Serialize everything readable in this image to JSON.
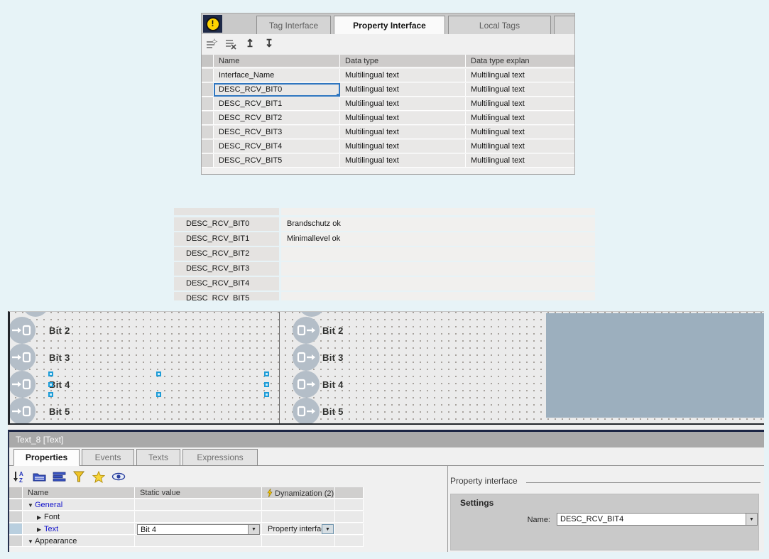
{
  "colors": {
    "page_bg": "#e7f3f7",
    "panel_bg": "#f0f0f0",
    "navy": "#1e2947",
    "warning_yellow": "#ffd400",
    "selection_blue": "#2f76c0",
    "handle_blue": "#1e9cd7",
    "link_blue": "#1313cb",
    "canvas_rect_blue_gray": "#9cafbe",
    "icon_circle_gray": "#b4bec8",
    "title_bar_gray": "#a9a9a9"
  },
  "top_panel": {
    "warning_icon": "warning-icon",
    "tabs": [
      {
        "label": "Tag Interface",
        "active": false
      },
      {
        "label": "Property Interface",
        "active": true
      },
      {
        "label": "Local Tags",
        "active": false
      }
    ],
    "toolbar_icons": [
      "add-row-icon",
      "delete-row-icon",
      "move-up-icon",
      "move-down-icon"
    ],
    "move_up_glyph": "↥",
    "move_down_glyph": "↧",
    "table": {
      "columns": [
        "Name",
        "Data type",
        "Data type explan"
      ],
      "rows": [
        {
          "name": "Interface_Name",
          "data_type": "Multilingual text",
          "explanation": "Multilingual text",
          "selected": false
        },
        {
          "name": "DESC_RCV_BIT0",
          "data_type": "Multilingual text",
          "explanation": "Multilingual text",
          "selected": true
        },
        {
          "name": "DESC_RCV_BIT1",
          "data_type": "Multilingual text",
          "explanation": "Multilingual text",
          "selected": false
        },
        {
          "name": "DESC_RCV_BIT2",
          "data_type": "Multilingual text",
          "explanation": "Multilingual text",
          "selected": false
        },
        {
          "name": "DESC_RCV_BIT3",
          "data_type": "Multilingual text",
          "explanation": "Multilingual text",
          "selected": false
        },
        {
          "name": "DESC_RCV_BIT4",
          "data_type": "Multilingual text",
          "explanation": "Multilingual text",
          "selected": false
        },
        {
          "name": "DESC_RCV_BIT5",
          "data_type": "Multilingual text",
          "explanation": "Multilingual text",
          "selected": false
        }
      ]
    }
  },
  "middle_table": {
    "rows": [
      {
        "name": "DESC_RCV_BIT0",
        "value": "Brandschutz ok"
      },
      {
        "name": "DESC_RCV_BIT1",
        "value": "Minimallevel ok"
      },
      {
        "name": "DESC_RCV_BIT2",
        "value": ""
      },
      {
        "name": "DESC_RCV_BIT3",
        "value": ""
      },
      {
        "name": "DESC_RCV_BIT4",
        "value": ""
      },
      {
        "name": "DESC_RCV_BIT5",
        "value": ""
      }
    ]
  },
  "canvas": {
    "left_items": [
      {
        "label": "Bit 2"
      },
      {
        "label": "Bit 3"
      },
      {
        "label": "Bit 4"
      },
      {
        "label": "Bit 5"
      }
    ],
    "right_items": [
      {
        "label": "Bit 2"
      },
      {
        "label": "Bit 3"
      },
      {
        "label": "Bit 4"
      },
      {
        "label": "Bit 5"
      }
    ],
    "selected_object": "Bit 4"
  },
  "bottom_panel": {
    "title": "Text_8 [Text]",
    "tabs": [
      {
        "label": "Properties",
        "active": true
      },
      {
        "label": "Events",
        "active": false
      },
      {
        "label": "Texts",
        "active": false
      },
      {
        "label": "Expressions",
        "active": false
      }
    ],
    "toolbar_icons": [
      "sort-az-icon",
      "category-view-icon",
      "list-view-icon",
      "filter-icon",
      "favorites-star-icon",
      "eye-icon"
    ],
    "table": {
      "columns": [
        "Name",
        "Static value",
        "Dynamization (2)"
      ],
      "rows": [
        {
          "name": "General",
          "expanded": true,
          "static_value": "",
          "dynamization": ""
        },
        {
          "name": "Font",
          "expanded": false,
          "static_value": "",
          "dynamization": ""
        },
        {
          "name": "Text",
          "expanded": false,
          "static_value": "Bit 4",
          "dynamization": "Property interface"
        },
        {
          "name": "Appearance",
          "expanded": true,
          "static_value": "",
          "dynamization": ""
        }
      ],
      "expanded_glyph": "▼",
      "collapsed_glyph": "▶",
      "dropdown_glyph": "▼"
    },
    "right_pane": {
      "heading": "Property interface",
      "group_title": "Settings",
      "name_label": "Name:",
      "name_value": "DESC_RCV_BIT4"
    }
  }
}
